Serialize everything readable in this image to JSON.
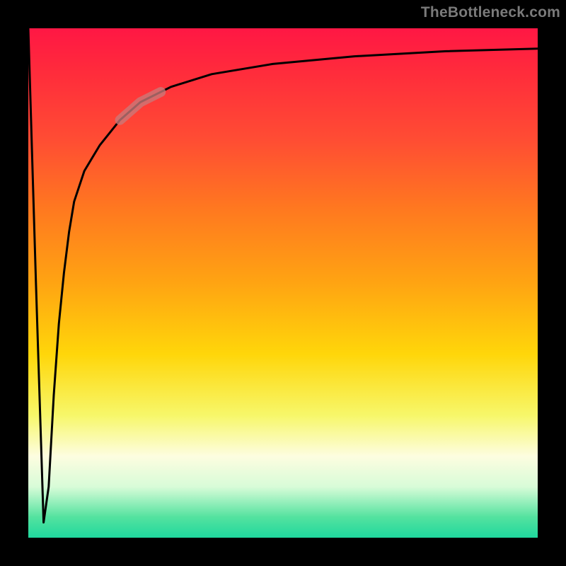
{
  "watermark": "TheBottleneck.com",
  "chart_data": {
    "type": "line",
    "title": "",
    "xlabel": "",
    "ylabel": "",
    "xlim": [
      0,
      100
    ],
    "ylim": [
      0,
      100
    ],
    "grid": false,
    "legend": false,
    "series": [
      {
        "name": "bottleneck-curve",
        "x": [
          0,
          1.5,
          3,
          4,
          5,
          6,
          7,
          8,
          9,
          11,
          14,
          18,
          22,
          28,
          36,
          48,
          64,
          82,
          100
        ],
        "y": [
          100,
          50,
          3,
          10,
          28,
          42,
          52,
          60,
          66,
          72,
          77,
          82,
          85.5,
          88.5,
          91,
          93,
          94.5,
          95.5,
          96
        ]
      }
    ],
    "highlight_segment": {
      "x_start": 18,
      "x_end": 26
    },
    "gradient_stops": [
      {
        "pos": 0.0,
        "color": "#ff1744"
      },
      {
        "pos": 0.22,
        "color": "#ff4d33"
      },
      {
        "pos": 0.5,
        "color": "#ffa412"
      },
      {
        "pos": 0.76,
        "color": "#f7f76a"
      },
      {
        "pos": 0.9,
        "color": "#d8fcd8"
      },
      {
        "pos": 1.0,
        "color": "#1fd89e"
      }
    ]
  }
}
